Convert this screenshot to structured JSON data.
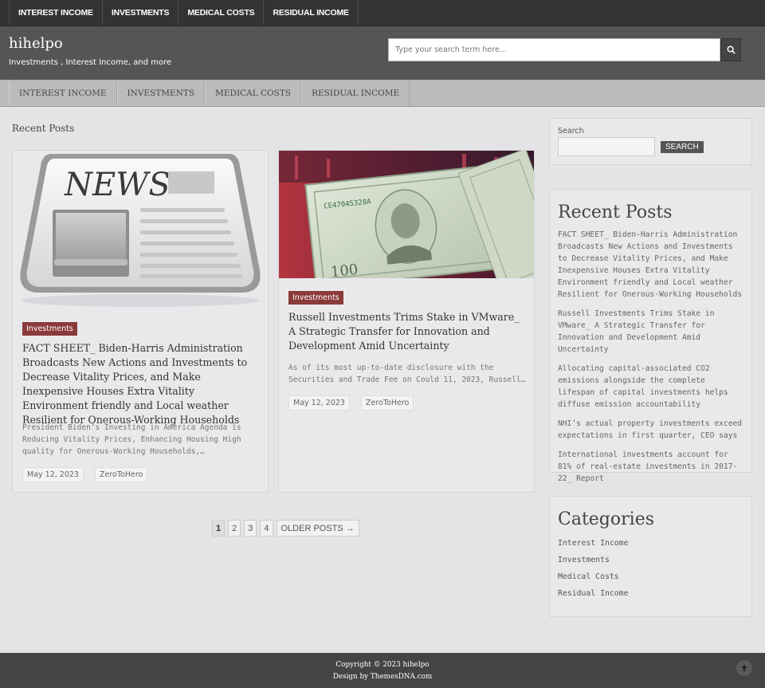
{
  "topnav": [
    "Interest Income",
    "Investments",
    "Medical Costs",
    "Residual Income"
  ],
  "site": {
    "title": "hihelpo",
    "tagline": "Investments , Interest Income, and more",
    "search_placeholder": "Type your search term here..."
  },
  "secnav": [
    "Interest Income",
    "Investments",
    "Medical Costs",
    "Residual Income"
  ],
  "main": {
    "heading": "Recent Posts",
    "posts": [
      {
        "category": "Investments",
        "title": "FACT SHEET_ Biden-Harris Administration Broadcasts New Actions and Investments to Decrease Vitality Prices, and Make Inexpensive Houses Extra Vitality Environment friendly and Local weather Resilient for Onerous-Working Households",
        "excerpt": "President Biden’s Investing in America Agenda is Reducing Vitality Prices, Enhancing Housing High quality for Onerous-Working Households,…",
        "date": "May 12, 2023",
        "author": "ZeroToHero",
        "image_text": "NEWS"
      },
      {
        "category": "Investments",
        "title": "Russell Investments Trims Stake in VMware_ A Strategic Transfer for Innovation and Development Amid Uncertainty",
        "excerpt": "As of its most up-to-date disclosure with the Securities and Trade Fee on Could 11, 2023, Russell…",
        "date": "May 12, 2023",
        "author": "ZeroToHero",
        "image_text": "100"
      }
    ],
    "pagination": {
      "pages": [
        "1",
        "2",
        "3",
        "4"
      ],
      "older": "Older Posts →"
    }
  },
  "sidebar": {
    "search_label": "Search",
    "search_button": "Search",
    "recent_title": "Recent Posts",
    "recent": [
      "FACT SHEET_ Biden-Harris Administration Broadcasts New Actions and Investments to Decrease Vitality Prices, and Make Inexpensive Houses Extra Vitality Environment friendly and Local weather Resilient for Onerous-Working Households",
      "Russell Investments Trims Stake in VMware_ A Strategic Transfer for Innovation and Development Amid Uncertainty",
      "Allocating capital-associated CO2 emissions alongside the complete lifespan of capital investments helps diffuse emission accountability",
      "NHI’s actual property investments exceed expectations in first quarter, CEO says",
      "International investments account for 81% of real-estate investments in 2017- 22_ Report"
    ],
    "categories_title": "Categories",
    "categories": [
      "Interest Income",
      "Investments",
      "Medical Costs",
      "Residual Income"
    ]
  },
  "footer": {
    "copyright": "Copyright © 2023 hihelpo",
    "design": "Design by ThemesDNA.com"
  },
  "colors": {
    "badge": "#8b3a3a",
    "topnav_bg": "#333333",
    "header_bg": "#555555",
    "footer_bg": "#444444"
  },
  "icons": [
    "search-icon",
    "arrow-up-icon"
  ]
}
